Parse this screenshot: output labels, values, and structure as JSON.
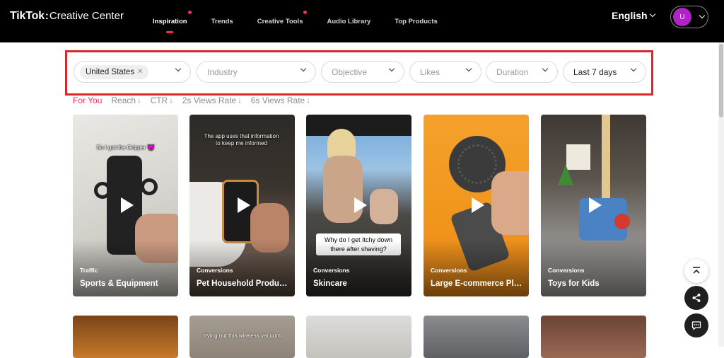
{
  "header": {
    "logo_main": "TikTok",
    "logo_sep": ":",
    "logo_sub": "Creative Center",
    "nav": [
      {
        "label": "Inspiration"
      },
      {
        "label": "Trends"
      },
      {
        "label": "Creative Tools"
      },
      {
        "label": "Audio Library"
      },
      {
        "label": "Top Products"
      }
    ],
    "language": "English",
    "avatar_initial": "U"
  },
  "filters": {
    "country_chip": "United States",
    "industry": "Industry",
    "objective": "Objective",
    "likes": "Likes",
    "duration": "Duration",
    "date_range": "Last 7 days"
  },
  "sorts": [
    {
      "label": "For You",
      "arrow": ""
    },
    {
      "label": "Reach",
      "arrow": "↓"
    },
    {
      "label": "CTR",
      "arrow": "↓"
    },
    {
      "label": "2s Views Rate",
      "arrow": "↓"
    },
    {
      "label": "6s Views Rate",
      "arrow": "↓"
    }
  ],
  "cards": [
    {
      "category": "Traffic",
      "title": "Sports & Equipment",
      "overlay": "So I got the Gripper 😈"
    },
    {
      "category": "Conversions",
      "title": "Pet Household Products",
      "overlay": "The app uses that information to keep me informed"
    },
    {
      "category": "Conversions",
      "title": "Skincare",
      "overlay": "Why do I get Itchy down there after shaving?"
    },
    {
      "category": "Conversions",
      "title": "Large E-commerce Platforms",
      "overlay": ""
    },
    {
      "category": "Conversions",
      "title": "Toys for Kids",
      "overlay": ""
    }
  ],
  "second_row": [
    {
      "overlay": ""
    },
    {
      "overlay": "trying out this wireless vacuum"
    },
    {
      "overlay": ""
    },
    {
      "overlay": ""
    },
    {
      "overlay": ""
    }
  ],
  "colors": {
    "accent": "#fe2c55",
    "highlight_box": "#d9272e"
  }
}
